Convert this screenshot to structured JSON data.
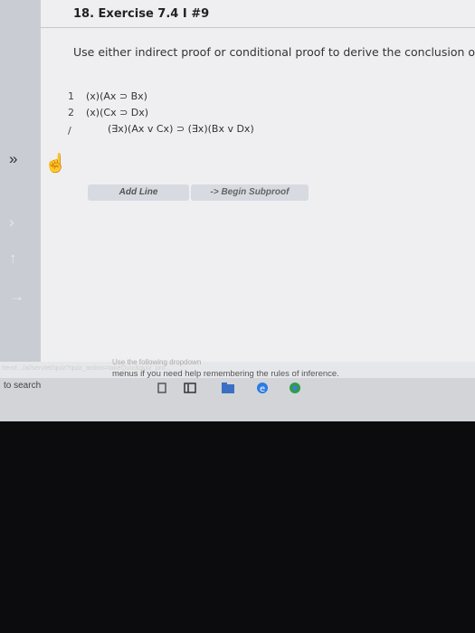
{
  "page": {
    "title": "18. Exercise 7.4 I #9",
    "instructions": "Use either indirect proof or conditional proof to derive the conclusion of the foll"
  },
  "proof": {
    "lines": [
      {
        "num": "1",
        "formula": "(x)(Ax ⊃ Bx)"
      },
      {
        "num": "2",
        "formula": "(x)(Cx ⊃ Dx)"
      }
    ],
    "conclusion_mark": "/",
    "conclusion": "(∃x)(Ax v Cx) ⊃ (∃x)(Bx v Dx)"
  },
  "buttons": {
    "add_line": "Add Line",
    "begin_subproof": "-> Begin Subproof"
  },
  "help": {
    "faint_text": "Use the following dropdown",
    "text": "menus if you need help remembering the rules of inference.",
    "url": "ttemf.../al/servlet/quiz?quiz_action=takeQuiz&quiz_pro..."
  },
  "taskbar": {
    "search_text": "to search"
  },
  "icons": {
    "left_sidebar": [
      "double-chevron-right-icon",
      "chevron-right-icon",
      "up-arrow-icon",
      "right-arrow-icon"
    ],
    "cursor": "hand-cursor-icon"
  }
}
